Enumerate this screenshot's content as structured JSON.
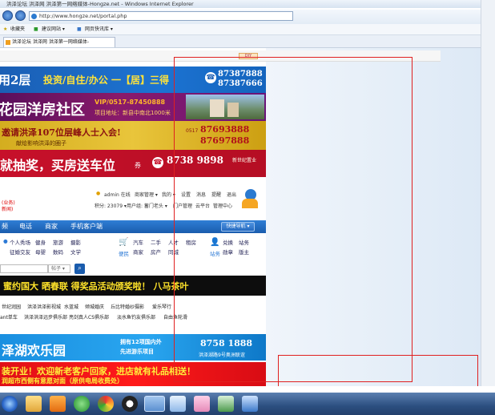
{
  "window": {
    "title": "洪泽论坛 洪泽网 洪泽第一网络媒体-Hongze.net - Windows Internet Explorer",
    "url": "http://www.hongze.net/portal.php"
  },
  "favorites": {
    "label": "收藏夹",
    "items": [
      "建议网站 ▾",
      "网页快讯库 ▾"
    ]
  },
  "tab": {
    "label": "洪泽论坛 洪泽网 洪泽第一网络媒体-Hongze.net"
  },
  "page": {
    "strip_mark": "DIY",
    "banner1": {
      "left": "用2层",
      "slogan": "投资/自住/办公 一【居】三得",
      "phone1": "87387888",
      "phone2": "87387666"
    },
    "banner2": {
      "left": "花园洋房社区",
      "note1": "VIP/0517-87450888",
      "note2": "项目地址：新县中南北1000米"
    },
    "banner3": {
      "main": "邀请洪泽107位层峰人士入会!",
      "sub": "献给影响洪泽的圈子",
      "area": "0517",
      "phone1": "87693888",
      "phone2": "87697888"
    },
    "banner4": {
      "main": "就抽奖，买房送车位",
      "suffix": "券",
      "phone": "8738 9898",
      "brand": "新世纪置业"
    },
    "user": {
      "left1": "(业务)",
      "left2": "新闻)",
      "row1": [
        "admin 在线",
        "商家管理 ▾",
        "我的 ▾",
        "设置",
        "消息",
        "提醒",
        "退出"
      ],
      "row2": [
        "积分: 23079 ▾",
        "用户组: 蓄门老头 ▾",
        "门户管理",
        "云平台",
        "管理中心"
      ]
    },
    "nav": {
      "items": [
        "频",
        "电话",
        "商家",
        "手机客户端"
      ],
      "quick": "快捷导航 ▾"
    },
    "categories": {
      "col1": [
        "个人秀场",
        "健身",
        "旅游",
        "摄影"
      ],
      "col1b": [
        "征婚交友",
        "母婴",
        "数码",
        "文学"
      ],
      "col2_label": "便民",
      "col2": [
        "汽车",
        "二手",
        "人才",
        "租房"
      ],
      "col2b": [
        "商家",
        "房产",
        "同城"
      ],
      "col3_label": "站务",
      "col3": [
        "兑换",
        "站务"
      ],
      "col3b": [
        "勋章",
        "版主"
      ]
    },
    "search": {
      "placeholder": "帖子 ▾"
    },
    "ticker": {
      "text": "蜜约国大  晒春联  得奖品活动颁奖啦！  八马茶叶"
    },
    "links": {
      "row1": [
        "世纪润园",
        "洪泽洪泽影视城",
        "水蓝城",
        "倾城婚庆",
        "丘比特婚纱摄影",
        "爱乐琴行"
      ],
      "row2": [
        "ant单车",
        "洪泽洪泽远步俱乐部",
        "亮剑真人CS俱乐部",
        "淡水鱼钓友俱乐部",
        "自由鱼轮滑"
      ]
    },
    "banner5": {
      "main": "泽湖欢乐园",
      "line1": "拥有12项国内外",
      "line2": "先进游乐项目",
      "phone": "8758 1888",
      "sub": "洪泽湖路9号奥洲联谊"
    },
    "banner6": {
      "line1": "装开业！欢迎新老客户回家，进店就有礼品相送！",
      "line2": "润超市西侧有意愿对面（原供电局收费处）"
    }
  },
  "colors": {
    "ie_blue": "#1c73d2",
    "red": "#e01018",
    "purple": "#6a1478",
    "gold": "#e9c53b"
  },
  "taskbar": {
    "icons": [
      "start-orb",
      "folder-icon",
      "media-player-icon",
      "ie-icon",
      "chrome-icon",
      "qq-icon",
      "ie-active-icon",
      "paint-icon",
      "app-icon",
      "tools-icon",
      "network-icon"
    ]
  }
}
